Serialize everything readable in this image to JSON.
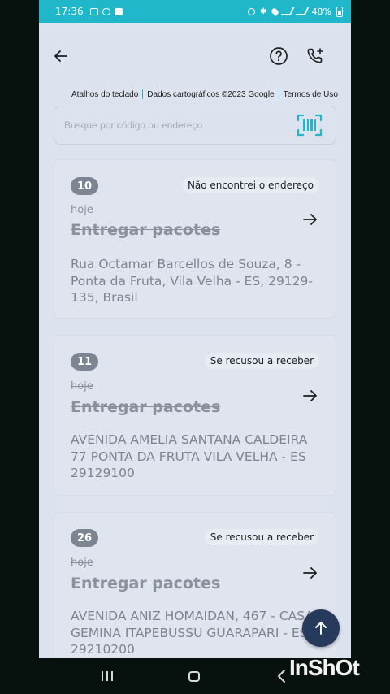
{
  "status_bar": {
    "time": "17:36",
    "battery": "48%"
  },
  "map_attribution": {
    "shortcuts": "Atalhos do teclado",
    "map_data": "Dados cartográficos ©2023 Google",
    "terms": "Termos de Uso"
  },
  "search": {
    "placeholder": "Busque por código ou endereço",
    "value": ""
  },
  "stops": [
    {
      "number": "10",
      "reason": "Não encontrei o endereço",
      "when": "hoje",
      "task": "Entregar pacotes",
      "address": "Rua Octamar Barcellos de Souza, 8 - Ponta da Fruta, Vila Velha - ES, 29129-135, Brasil"
    },
    {
      "number": "11",
      "reason": "Se recusou a receber",
      "when": "hoje",
      "task": "Entregar pacotes",
      "address": "AVENIDA AMELIA SANTANA CALDEIRA 77 PONTA DA FRUTA VILA VELHA - ES 29129100"
    },
    {
      "number": "26",
      "reason": "Se recusou a receber",
      "when": "hoje",
      "task": "Entregar pacotes",
      "address": "AVENIDA ANIZ HOMAIDAN, 467 - CASA GEMINA ITAPEBUSSU GUARAPARI - ES 29210200"
    }
  ],
  "watermark": "InShOt",
  "icons": {
    "back": "arrow-left-icon",
    "help": "question-circle-icon",
    "call": "phone-add-icon",
    "scan": "barcode-scan-icon",
    "go": "arrow-right-icon",
    "scroll_top": "arrow-up-icon"
  },
  "colors": {
    "status_bar": "#1fb7c9",
    "screen_bg": "#dde3ee",
    "badge": "#7e8592",
    "fab": "#263a5c",
    "scan_accent": "#1fb7c9"
  }
}
